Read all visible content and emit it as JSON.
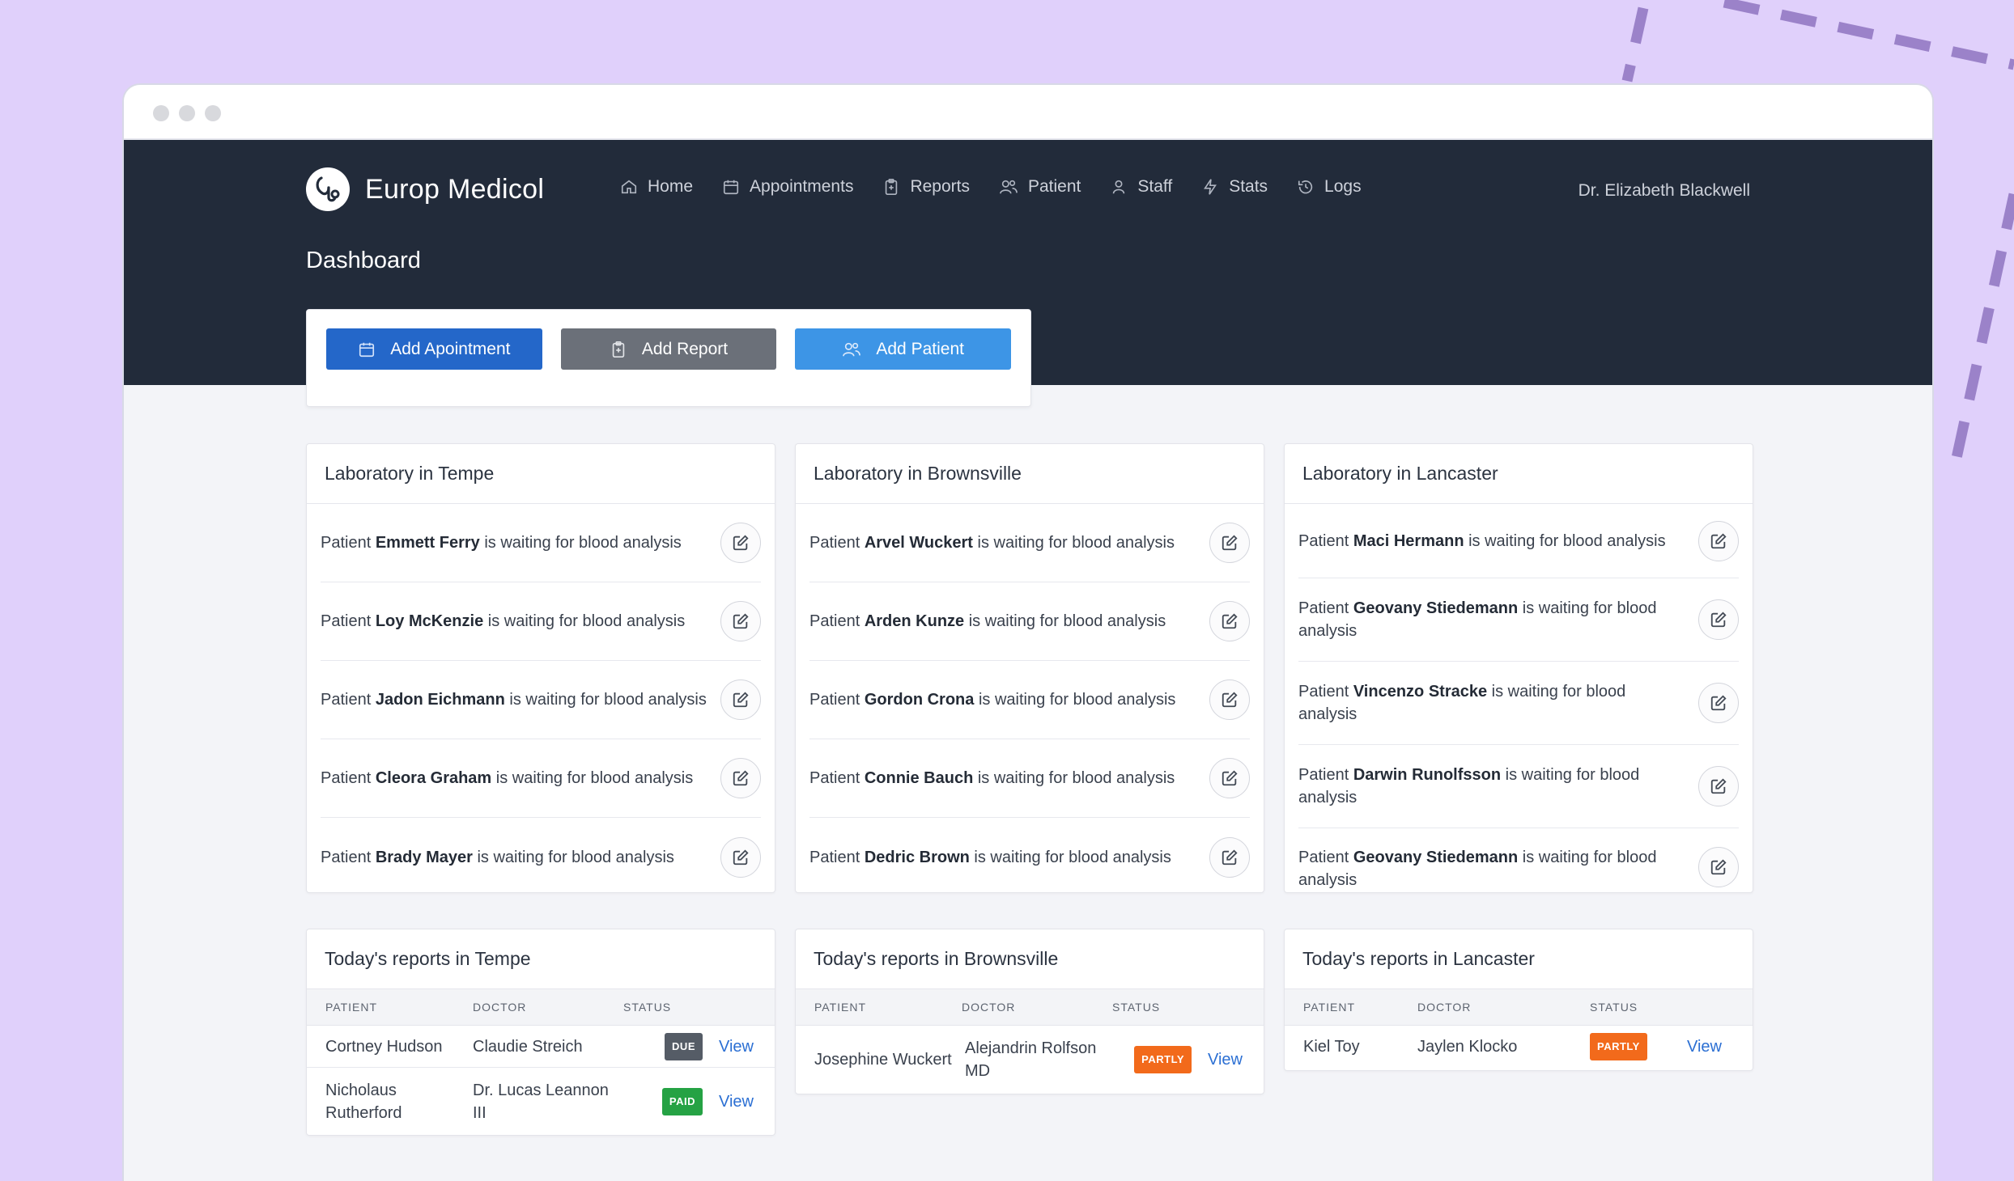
{
  "app": {
    "name": "Europ Medicol",
    "page_title": "Dashboard",
    "user": "Dr. Elizabeth Blackwell"
  },
  "nav": {
    "items": [
      {
        "label": "Home",
        "icon": "home-icon"
      },
      {
        "label": "Appointments",
        "icon": "calendar-icon"
      },
      {
        "label": "Reports",
        "icon": "clipboard-icon"
      },
      {
        "label": "Patient",
        "icon": "users-icon"
      },
      {
        "label": "Staff",
        "icon": "user-icon"
      },
      {
        "label": "Stats",
        "icon": "bolt-icon"
      },
      {
        "label": "Logs",
        "icon": "history-icon"
      }
    ]
  },
  "actions": {
    "add_appointment": "Add Apointment",
    "add_report": "Add Report",
    "add_patient": "Add Patient"
  },
  "labs": [
    {
      "title": "Laboratory in Tempe",
      "items": [
        {
          "prefix": "Patient",
          "name": "Emmett Ferry",
          "suffix": "is waiting for blood analysis"
        },
        {
          "prefix": "Patient",
          "name": "Loy McKenzie",
          "suffix": "is waiting for blood analysis"
        },
        {
          "prefix": "Patient",
          "name": "Jadon Eichmann",
          "suffix": "is waiting for blood analysis"
        },
        {
          "prefix": "Patient",
          "name": "Cleora Graham",
          "suffix": "is waiting for blood analysis"
        },
        {
          "prefix": "Patient",
          "name": "Brady Mayer",
          "suffix": "is waiting for blood analysis"
        }
      ]
    },
    {
      "title": "Laboratory in Brownsville",
      "items": [
        {
          "prefix": "Patient",
          "name": "Arvel Wuckert",
          "suffix": "is waiting for blood analysis"
        },
        {
          "prefix": "Patient",
          "name": "Arden Kunze",
          "suffix": "is waiting for blood analysis"
        },
        {
          "prefix": "Patient",
          "name": "Gordon Crona",
          "suffix": "is waiting for blood analysis"
        },
        {
          "prefix": "Patient",
          "name": "Connie Bauch",
          "suffix": "is waiting for blood analysis"
        },
        {
          "prefix": "Patient",
          "name": "Dedric Brown",
          "suffix": "is waiting for blood analysis"
        }
      ]
    },
    {
      "title": "Laboratory in Lancaster",
      "items": [
        {
          "prefix": "Patient",
          "name": "Maci Hermann",
          "suffix": "is waiting for blood analysis"
        },
        {
          "prefix": "Patient",
          "name": "Geovany Stiedemann",
          "suffix": "is waiting for blood analysis"
        },
        {
          "prefix": "Patient",
          "name": "Vincenzo Stracke",
          "suffix": "is waiting for blood analysis"
        },
        {
          "prefix": "Patient",
          "name": "Darwin Runolfsson",
          "suffix": "is waiting for blood analysis"
        },
        {
          "prefix": "Patient",
          "name": "Geovany Stiedemann",
          "suffix": "is waiting for blood analysis"
        }
      ]
    }
  ],
  "report_columns": {
    "patient": "PATIENT",
    "doctor": "DOCTOR",
    "status": "STATUS"
  },
  "reports": [
    {
      "title": "Today's reports in Tempe",
      "rows": [
        {
          "patient": "Cortney Hudson",
          "doctor": "Claudie Streich",
          "status": "DUE",
          "action": "View"
        },
        {
          "patient": "Nicholaus Rutherford",
          "doctor": "Dr. Lucas Leannon III",
          "status": "PAID",
          "action": "View"
        }
      ]
    },
    {
      "title": "Today's reports in Brownsville",
      "rows": [
        {
          "patient": "Josephine Wuckert",
          "doctor": "Alejandrin Rolfson MD",
          "status": "PARTLY",
          "action": "View"
        }
      ]
    },
    {
      "title": "Today's reports in Lancaster",
      "rows": [
        {
          "patient": "Kiel Toy",
          "doctor": "Jaylen Klocko",
          "status": "PARTLY",
          "action": "View"
        }
      ]
    }
  ],
  "colors": {
    "background": "#e0d0fb",
    "header": "#222b3a",
    "primary": "#2467c9",
    "secondary": "#6b7079",
    "info": "#3d95e6",
    "status_due": "#555c66",
    "status_paid": "#25a244",
    "status_partly": "#f26a1b",
    "link": "#2b6fd3"
  }
}
